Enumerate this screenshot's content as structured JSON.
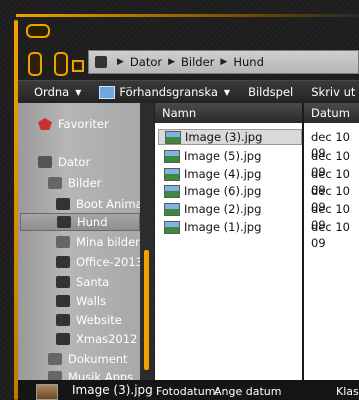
{
  "nav": {
    "crumbs": [
      "Dator",
      "Bilder",
      "Hund"
    ]
  },
  "toolbar": {
    "organize": "Ordna",
    "preview": "Förhandsgranska",
    "slideshow": "Bildspel",
    "print": "Skriv ut"
  },
  "sidebar": {
    "favorites": "Favoriter",
    "computer": "Dator",
    "pictures": "Bilder",
    "items": [
      "Boot Animat",
      "Hund",
      "Mina bilder",
      "Office-2013-",
      "Santa",
      "Walls",
      "Website",
      "Xmas2012"
    ],
    "documents": "Dokument",
    "music": "Musik Apps"
  },
  "columns": {
    "name": "Namn",
    "date": "Datum"
  },
  "files": [
    {
      "name": "Image (3).jpg",
      "date": "dec 10 09"
    },
    {
      "name": "Image (5).jpg",
      "date": "dec 10 09"
    },
    {
      "name": "Image (4).jpg",
      "date": "dec 10 09"
    },
    {
      "name": "Image (6).jpg",
      "date": "dec 10 09"
    },
    {
      "name": "Image (2).jpg",
      "date": "dec 10 09"
    },
    {
      "name": "Image (1).jpg",
      "date": "dec 10 09"
    }
  ],
  "status": {
    "filename": "Image (3).jpg",
    "date_label": "Fotodatum:",
    "date_value": "Ange datum",
    "extra": "Klass"
  },
  "colors": {
    "accent": "#f2a200"
  }
}
